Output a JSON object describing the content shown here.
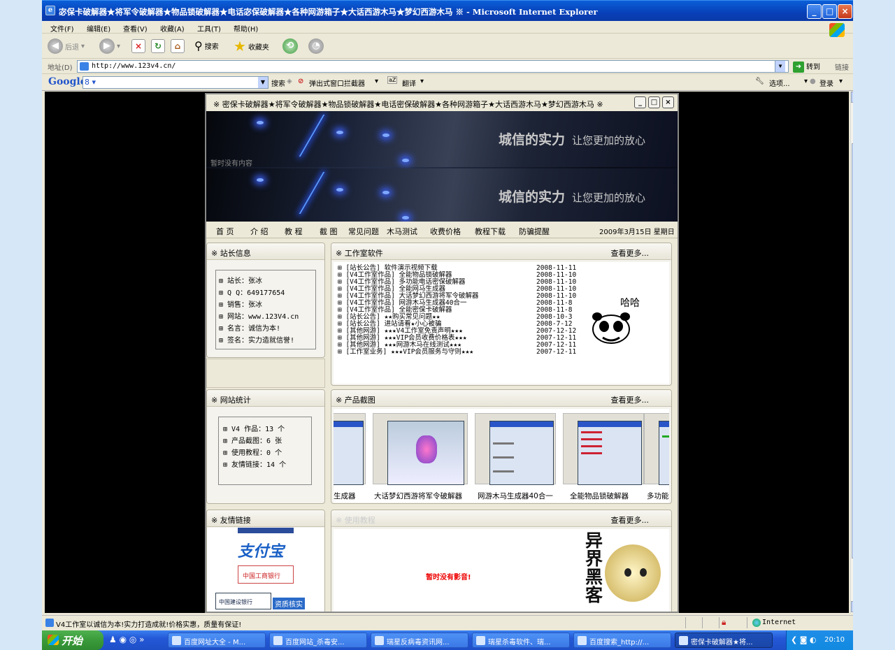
{
  "window": {
    "title": "宓保卡破解器★将军令破解器★物品锁破解器★电话宓保破解器★各种网游箱子★大话西游木马★梦幻西游木马 ※ - Microsoft Internet Explorer",
    "app_icon": "ie-icon",
    "controls": {
      "min": "_",
      "max": "□",
      "close": "×"
    }
  },
  "menubar": {
    "items": [
      "文件(F)",
      "编辑(E)",
      "查看(V)",
      "收藏(A)",
      "工具(T)",
      "帮助(H)"
    ]
  },
  "toolbar": {
    "back_label": "后退",
    "search_label": "搜索",
    "favorites_label": "收藏夹"
  },
  "address": {
    "label": "地址(D)",
    "url": "http://www.123v4.cn/",
    "go_label": "转到",
    "links_label": "链接"
  },
  "googlebar": {
    "logo": "Google",
    "search_value": "",
    "search_button": "搜索",
    "popup_blocker": "弹出式窗口拦截器",
    "translate": "翻译",
    "options": "选项...",
    "login": "登录"
  },
  "popup": {
    "title": "※ 密保卡破解器★将军令破解器★物品锁破解器★电话密保破解器★各种网游箱子★大话西游木马★梦幻西游木马 ※",
    "banner_slogan_main": "城信的实力",
    "banner_slogan_sub": "让您更加的放心",
    "banner_overlay": "暂时没有内容"
  },
  "nav": {
    "items": [
      "首 页",
      "介 绍",
      "教 程",
      "截 图",
      "常见问题",
      "木马测试",
      "收费价格",
      "教程下载",
      "防骗提醒"
    ],
    "date": "2009年3月15日 星期日"
  },
  "owner_panel": {
    "title": "※ 站长信息",
    "items": [
      "⊞ 站长：张冰",
      "⊞ Q Q：649177654",
      "⊞ 销售：张冰",
      "⊞ 网站：www.123V4.cn",
      "⊞ 名言：诚信为本!",
      "⊞ 签名：实力造就信誉!"
    ]
  },
  "software_panel": {
    "title": "※ 工作室软件",
    "more": "查看更多...",
    "rows": [
      {
        "text": "⊞ [站长公告] 软件演示视频下载",
        "date": "2008-11-11"
      },
      {
        "text": "⊞ [V4工作室作品] 全能物品锁破解器",
        "date": "2008-11-10"
      },
      {
        "text": "⊞ [V4工作室作品] 多功能电话密保破解器",
        "date": "2008-11-10"
      },
      {
        "text": "⊞ [V4工作室作品] 全能网马生成器",
        "date": "2008-11-10"
      },
      {
        "text": "⊞ [V4工作室作品] 大话梦幻西游将军令破解器",
        "date": "2008-11-10"
      },
      {
        "text": "⊞ [V4工作室作品] 网游木马生成器40合一",
        "date": "2008-11-8"
      },
      {
        "text": "⊞ [V4工作室作品] 全能密保卡破解器",
        "date": "2008-11-8"
      },
      {
        "text": "⊞ [站长公告] ★★购买常见问题★★",
        "date": "2008-10-3"
      },
      {
        "text": "⊞ [站长公告] 进站请看★小心被骗",
        "date": "2008-7-12"
      },
      {
        "text": "⊞ [其他网游] ★★★V4工作室免责声明★★★",
        "date": "2007-12-12"
      },
      {
        "text": "⊞ [其他网游] ★★★VIP会员收费价格表★★★",
        "date": "2007-12-11"
      },
      {
        "text": "⊞ [其他网游] ★★★网游木马在线测试★★★",
        "date": "2007-12-11"
      },
      {
        "text": "⊞ [工作室业务] ★★★VIP会员服务与守则★★★",
        "date": "2007-12-11"
      }
    ],
    "mascot_text": "哈哈"
  },
  "stats_panel": {
    "title": "※ 网站统计",
    "items": [
      "⊞  V4 作品：13 个",
      "⊞ 产品截图：6 张",
      "⊞ 使用教程：0 个",
      "⊞ 友情链接：14 个"
    ]
  },
  "screenshots_panel": {
    "title": "※ 产品截图",
    "more": "查看更多...",
    "captions": [
      "生成器",
      "大话梦幻西游将军令破解器",
      "网游木马生成器40合一",
      "全能物品锁破解器",
      "多功能"
    ]
  },
  "links_panel": {
    "title": "※ 友情链接",
    "logos": [
      "支付宝",
      "中国工商银行",
      "中国建设银行",
      "资质核实"
    ]
  },
  "tutorials_panel": {
    "title": "※ 使用教程",
    "more": "查看更多...",
    "empty_text": "暂时没有影音!",
    "side_text": "异界黑客"
  },
  "statusbar": {
    "text": "V4工作室以诚信为本!实力打造成就!价格实惠，质量有保证!",
    "zone": "Internet"
  },
  "taskbar": {
    "start": "开始",
    "tasks": [
      "百度网址大全 - M...",
      "百度网站_杀毒安...",
      "瑞星反病毒资讯网...",
      "瑞星杀毒软件、瑞...",
      "百度搜索_http://...",
      "密保卡破解器★将..."
    ],
    "clock": "20:10"
  }
}
